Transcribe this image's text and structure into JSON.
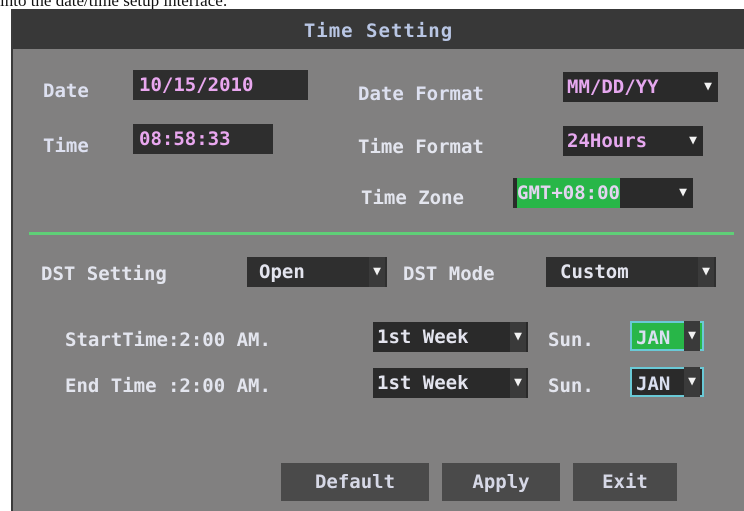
{
  "caption": "into the date/time setup interface:",
  "window": {
    "title": "Time Setting"
  },
  "date": {
    "label": "Date",
    "value": "10/15/2010"
  },
  "time": {
    "label": "Time",
    "value": "08:58:33"
  },
  "date_format": {
    "label": "Date Format",
    "value": "MM/DD/YY"
  },
  "time_format": {
    "label": "Time Format",
    "value": "24Hours"
  },
  "time_zone": {
    "label": "Time Zone",
    "value": "GMT+08:00"
  },
  "dst": {
    "setting_label": "DST Setting",
    "setting_value": "Open",
    "mode_label": "DST Mode",
    "mode_value": "Custom"
  },
  "start": {
    "label": "StartTime:2:00 AM.",
    "week": "1st Week",
    "day": "Sun.",
    "month": "JAN"
  },
  "end": {
    "label": "End Time :2:00 AM.",
    "week": "1st Week",
    "day": "Sun.",
    "month": "JAN"
  },
  "buttons": {
    "default": "Default",
    "apply": "Apply",
    "exit": "Exit"
  },
  "colors": {
    "panel": "#818080",
    "titlebar": "#383838",
    "divider": "#5fcf77",
    "highlight": "#28b648",
    "value_text": "#e9a7ef"
  }
}
